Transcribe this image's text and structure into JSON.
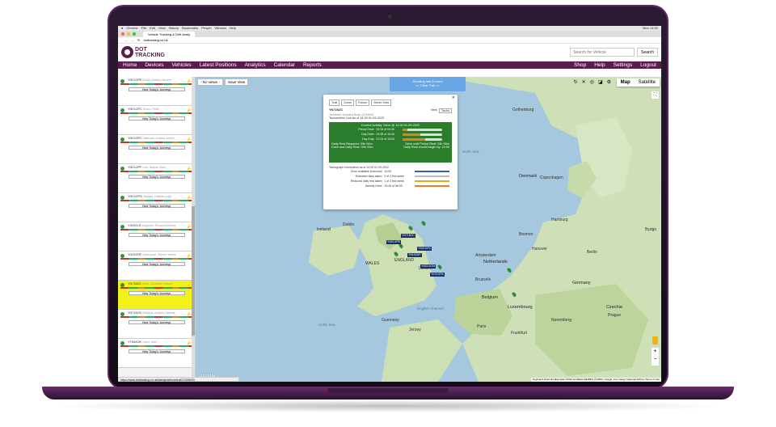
{
  "mac_menu": [
    "Chrome",
    "File",
    "Edit",
    "View",
    "History",
    "Bookmarks",
    "People",
    "Window",
    "Help"
  ],
  "mac_clock": "Mon 14:30",
  "browser": {
    "tab_title": "Vehicle Tracking & Drift Analy",
    "url": "dottracking.co.uk"
  },
  "brand": {
    "line1": "DOT",
    "line2": "TRACKING",
    "color": "#5a1e4e"
  },
  "search": {
    "placeholder": "Search for Vehicle",
    "button": "Search"
  },
  "nav": {
    "left": [
      "Home",
      "Devices",
      "Vehicles",
      "Latest Positions",
      "Analytics",
      "Calendar",
      "Reports"
    ],
    "right": [
      "Shop",
      "Help",
      "Settings",
      "Logout"
    ]
  },
  "map_controls": {
    "views_select": "- No views -",
    "save_view": "Save View",
    "map": "Map",
    "satellite": "Satellite"
  },
  "showing": {
    "line1": "Showing last 3 hours",
    "line2": "<< Clear Trail >>"
  },
  "vehicles": [
    {
      "reg": "YN21GPE",
      "name": "Booth, Andrew Vincent",
      "link": "View Today's Journeys"
    },
    {
      "reg": "YN21GPC",
      "name": "Green, Peter",
      "link": "View Today's Journeys"
    },
    {
      "reg": "YN21GPC",
      "name": "Tattersall, Andrew James",
      "link": "View Today's Journeys"
    },
    {
      "reg": "YN21GPF",
      "name": "Carr, Nathan Mark",
      "link": "View Today's Journeys"
    },
    {
      "reg": "YN21GPG",
      "name": "Tankard, Kristian Leigh",
      "link": "View Today's Journeys"
    },
    {
      "reg": "YJ69GLS",
      "name": "Singleton, Richard Anthony",
      "link": "View Today's Journeys"
    },
    {
      "reg": "YN19ZDP",
      "name": "Gatehouse, Steven James",
      "link": "View Today's Journeys"
    },
    {
      "reg": "YN71NZC",
      "name": "Bush, Jonathan Howard",
      "link": "View Today's Journeys"
    },
    {
      "reg": "YN71NZD",
      "name": "Williams, Andrew Thomas",
      "link": "View Today's Journeys"
    },
    {
      "reg": "YT69AOK",
      "name": "Joyce, Alan",
      "link": "View Today's Journeys"
    }
  ],
  "status_url": "https://www.dottracking.co.uk/latestpositions/trail/21008093",
  "popup": {
    "tabs": [
      "Trail",
      "Zoom",
      "Follow",
      "Street View"
    ],
    "reg": "YN71NZC",
    "driver": "Jonathan Howard Bush (118944)",
    "view_label": "View",
    "view_value": "Tacho",
    "tacho_live": "Tachometer Live as of 14:30 01-09-2022",
    "current": "Current Activity: Drive @ 14:30 01-09-2022",
    "rows": [
      {
        "k": "Period Drive:",
        "v": "00:34 of 04:30",
        "p": 0.13
      },
      {
        "k": "Day Drive:",
        "v": "04:35 of 10:00",
        "p": 0.46
      },
      {
        "k": "Day Duty:",
        "v": "07:24 of 13:00",
        "p": 0.57
      }
    ],
    "rest_left": "Daily Rest Required: 09h 00m",
    "rest_right": "Drive until Period Rest: 03h 56m",
    "rest_left2": "Drive and Daily Rest: 09h 00m",
    "rest_right2": "Daily Rest should begin by: 22:30",
    "tacho_info": "Tachograph Information as of 14:30 01-09-2022",
    "tacho_rows": [
      {
        "k": "Drive available tomorrow:",
        "v": "10:00"
      },
      {
        "k": "Extended days taken:",
        "v": "0 of 2 this week"
      },
      {
        "k": "Reduced daily rest taken:",
        "v": "1 of 3 this week"
      },
      {
        "k": "Weekly Drive:",
        "v": "24:46 of 56:00"
      }
    ]
  },
  "map_labels": [
    {
      "t": "Ireland",
      "c": "big"
    },
    {
      "t": "Dublin",
      "c": ""
    },
    {
      "t": "WALES",
      "c": ""
    },
    {
      "t": "ENGLAND",
      "c": ""
    },
    {
      "t": "London",
      "c": ""
    },
    {
      "t": "North Sea",
      "c": "sea"
    },
    {
      "t": "Denmark",
      "c": "big"
    },
    {
      "t": "Copenhagen",
      "c": ""
    },
    {
      "t": "Gothenburg",
      "c": ""
    },
    {
      "t": "Hamburg",
      "c": ""
    },
    {
      "t": "Bremen",
      "c": ""
    },
    {
      "t": "Amsterdam",
      "c": ""
    },
    {
      "t": "Netherlands",
      "c": "big"
    },
    {
      "t": "Hanover",
      "c": ""
    },
    {
      "t": "Berlin",
      "c": ""
    },
    {
      "t": "Germany",
      "c": "big"
    },
    {
      "t": "Belgium",
      "c": "big"
    },
    {
      "t": "Brussels",
      "c": ""
    },
    {
      "t": "Luxembourg",
      "c": "big"
    },
    {
      "t": "Paris",
      "c": ""
    },
    {
      "t": "Frankfurt",
      "c": ""
    },
    {
      "t": "Czechia",
      "c": "big"
    },
    {
      "t": "Prague",
      "c": ""
    },
    {
      "t": "Nuremberg",
      "c": ""
    },
    {
      "t": "Guernsey",
      "c": ""
    },
    {
      "t": "Jersey",
      "c": ""
    },
    {
      "t": "Celtic Sea",
      "c": "sea"
    },
    {
      "t": "English Channel",
      "c": "sea"
    },
    {
      "t": "Bydgo",
      "c": ""
    }
  ],
  "tags": [
    "YN71NZC",
    "YN21GPE",
    "YN21GPC",
    "YN21GOM",
    "YK21GPA",
    "YN19ZDP"
  ],
  "attribution": "Keyboard shortcuts  Map data ©2022 GeoBasis-DE/BKG (©2009), Google, Inst. Geogr. Nacional  100 km  Terms of Use"
}
